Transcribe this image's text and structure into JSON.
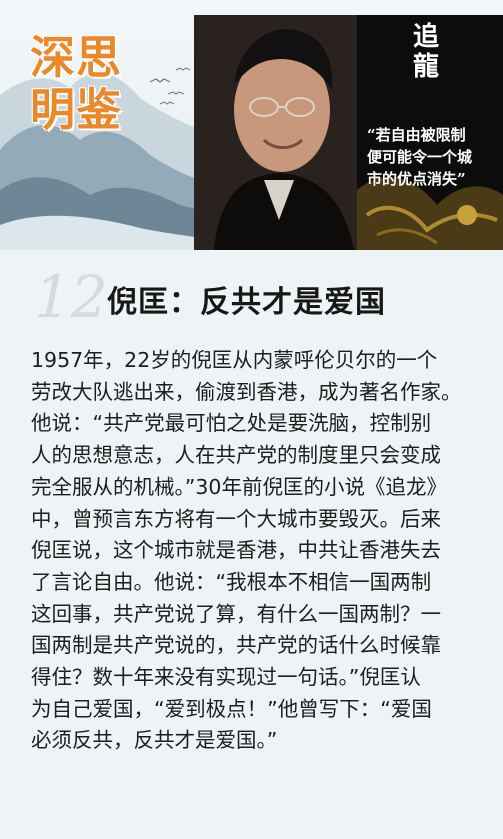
{
  "header": {
    "series_title_line1": "深思",
    "series_title_line2": "明鉴",
    "book_title_line1": "追",
    "book_title_line2": "龍",
    "book_quote_lines": [
      "“若自由被限制",
      "便可能令一个城",
      "市的优点消失”"
    ]
  },
  "article": {
    "number": "12",
    "title": "倪匡：反共才是爱国",
    "body_lines": [
      "1957年，22岁的倪匡从内蒙呼伦贝尔的一个",
      "劳改大队逃出来，偷渡到香港，成为著名作家。",
      "他说：“共产党最可怕之处是要洗脑，控制别",
      "人的思想意志，人在共产党的制度里只会变成",
      "完全服从的机械。”30年前倪匡的小说《追龙》",
      "中，曾预言东方将有一个大城市要毁灭。后来",
      "倪匡说，这个城市就是香港，中共让香港失去",
      "了言论自由。他说：“我根本不相信一国两制",
      "这回事，共产党说了算，有什么一国两制？一",
      "国两制是共产党说的，共产党的话什么时候靠",
      "得住？数十年来没有实现过一句话。”倪匡认",
      "为自己爱国，“爱到极点！”他曾写下：“爱国",
      "必须反共，反共才是爱国。”"
    ]
  }
}
